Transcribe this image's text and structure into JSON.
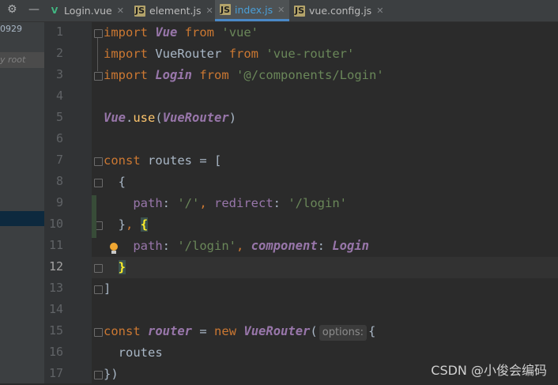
{
  "tabs": [
    {
      "label": "Login.vue",
      "icon": "vue-icon",
      "active": false
    },
    {
      "label": "element.js",
      "icon": "js-file-icon",
      "active": false
    },
    {
      "label": "index.js",
      "icon": "js-file-icon",
      "active": true
    },
    {
      "label": "vue.config.js",
      "icon": "js-file-icon",
      "active": false
    }
  ],
  "left_panel": {
    "partial_text": "0929",
    "root_label": "y root"
  },
  "line_numbers": [
    "1",
    "2",
    "3",
    "4",
    "5",
    "6",
    "7",
    "8",
    "9",
    "10",
    "11",
    "12",
    "13",
    "14",
    "15",
    "16",
    "17"
  ],
  "current_line": "12",
  "code": {
    "l1": {
      "kw": "import",
      "id": "Vue",
      "kw2": "from",
      "str": "'vue'"
    },
    "l2": {
      "kw": "import",
      "id": "VueRouter",
      "kw2": "from",
      "str": "'vue-router'"
    },
    "l3": {
      "kw": "import",
      "id": "Login",
      "kw2": "from",
      "str": "'@/components/Login'"
    },
    "l5": {
      "obj": "Vue",
      "dot": ".",
      "fn": "use",
      "open": "(",
      "arg": "VueRouter",
      "close": ")"
    },
    "l7": {
      "kw": "const",
      "name": "routes",
      "eq": "=",
      "bracket": "["
    },
    "l8": {
      "brace": "{"
    },
    "l9": {
      "key1": "path",
      "val1": "'/'",
      "key2": "redirect",
      "val2": "'/login'"
    },
    "l10": {
      "close": "}",
      "comma": ",",
      "open": "{"
    },
    "l11": {
      "key1": "path",
      "val1": "'/login'",
      "key2": "component",
      "val2": "Login"
    },
    "l12": {
      "close": "}"
    },
    "l13": {
      "bracket": "]"
    },
    "l15": {
      "kw": "const",
      "name": "router",
      "eq": "=",
      "kw2": "new",
      "cls": "VueRouter",
      "open": "(",
      "hint": "options:",
      "brace": "{"
    },
    "l16": {
      "text": "routes"
    },
    "l17": {
      "text": "})"
    }
  },
  "watermark": "CSDN @小俊会编码"
}
